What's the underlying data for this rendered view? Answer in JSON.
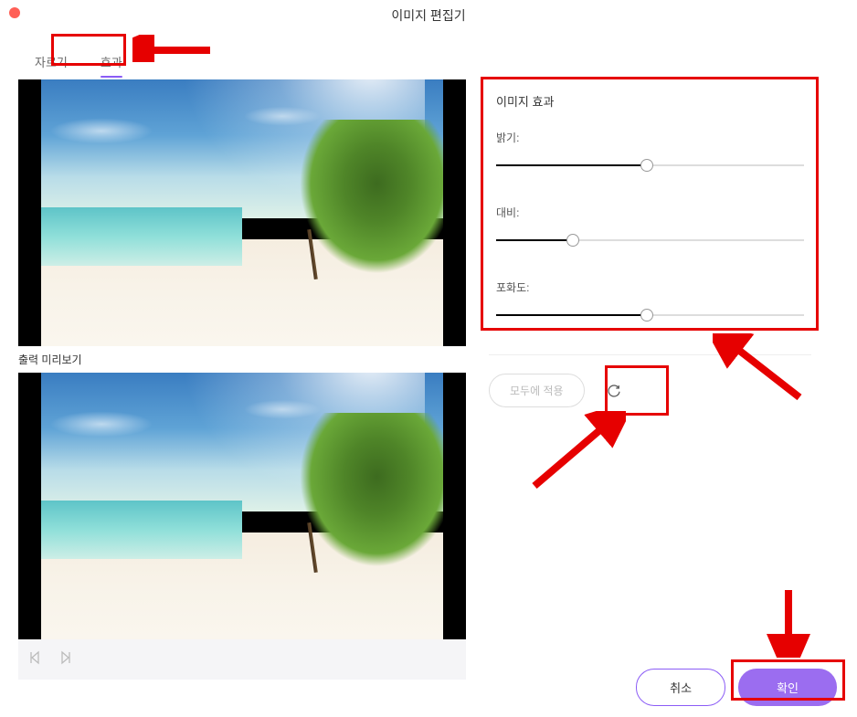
{
  "window": {
    "title": "이미지 편집기"
  },
  "tabs": {
    "crop": "자르기",
    "effects": "효과"
  },
  "preview": {
    "output_label": "출력 미리보기"
  },
  "panel": {
    "title": "이미지 효과",
    "sliders": {
      "brightness": {
        "label": "밝기:",
        "value_percent": 49
      },
      "contrast": {
        "label": "대비:",
        "value_percent": 25
      },
      "saturation": {
        "label": "포화도:",
        "value_percent": 49
      }
    }
  },
  "actions": {
    "apply_all": "모두에 적용",
    "reset_icon": "reset-icon"
  },
  "footer": {
    "cancel": "취소",
    "ok": "확인"
  },
  "annotations": {
    "color": "#e60000",
    "highlights": [
      "tab-effects",
      "effects-panel",
      "reset-button",
      "ok-button"
    ]
  }
}
